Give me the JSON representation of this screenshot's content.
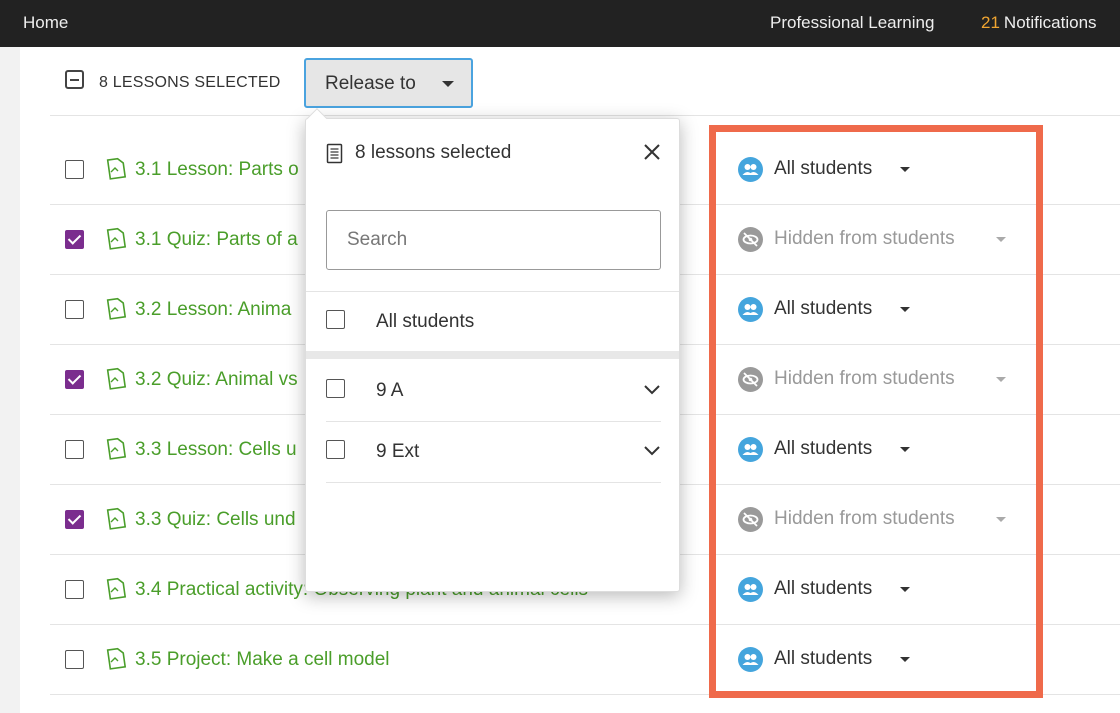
{
  "topbar": {
    "home": "Home",
    "professional_learning": "Professional Learning",
    "notifications_count": "21",
    "notifications_label": "Notifications"
  },
  "selection": {
    "count_label": "8 LESSONS SELECTED",
    "release_button": "Release to"
  },
  "rows": [
    {
      "title": "3.1 Lesson: Parts o",
      "checked": false,
      "release": "All students",
      "hidden": false
    },
    {
      "title": "3.1 Quiz: Parts of a",
      "checked": true,
      "release": "Hidden from students",
      "hidden": true
    },
    {
      "title": "3.2 Lesson: Anima",
      "checked": false,
      "release": "All students",
      "hidden": false
    },
    {
      "title": "3.2 Quiz: Animal vs",
      "checked": true,
      "release": "Hidden from students",
      "hidden": true
    },
    {
      "title": "3.3 Lesson: Cells u",
      "checked": false,
      "release": "All students",
      "hidden": false
    },
    {
      "title": "3.3 Quiz: Cells und",
      "checked": true,
      "release": "Hidden from students",
      "hidden": true
    },
    {
      "title": "3.4 Practical activity: Observing plant and animal cells",
      "checked": false,
      "release": "All students",
      "hidden": false
    },
    {
      "title": "3.5 Project: Make a cell model",
      "checked": false,
      "release": "All students",
      "hidden": false
    }
  ],
  "popover": {
    "header": "8 lessons selected",
    "search_placeholder": "Search",
    "all_students": "All students",
    "groups": [
      "9 A",
      "9 Ext"
    ]
  },
  "colors": {
    "accent_green": "#4a9e2a",
    "checkbox_purple": "#7b2d8e",
    "avatar_blue": "#44a5dd",
    "highlight": "#ef6a4b"
  }
}
